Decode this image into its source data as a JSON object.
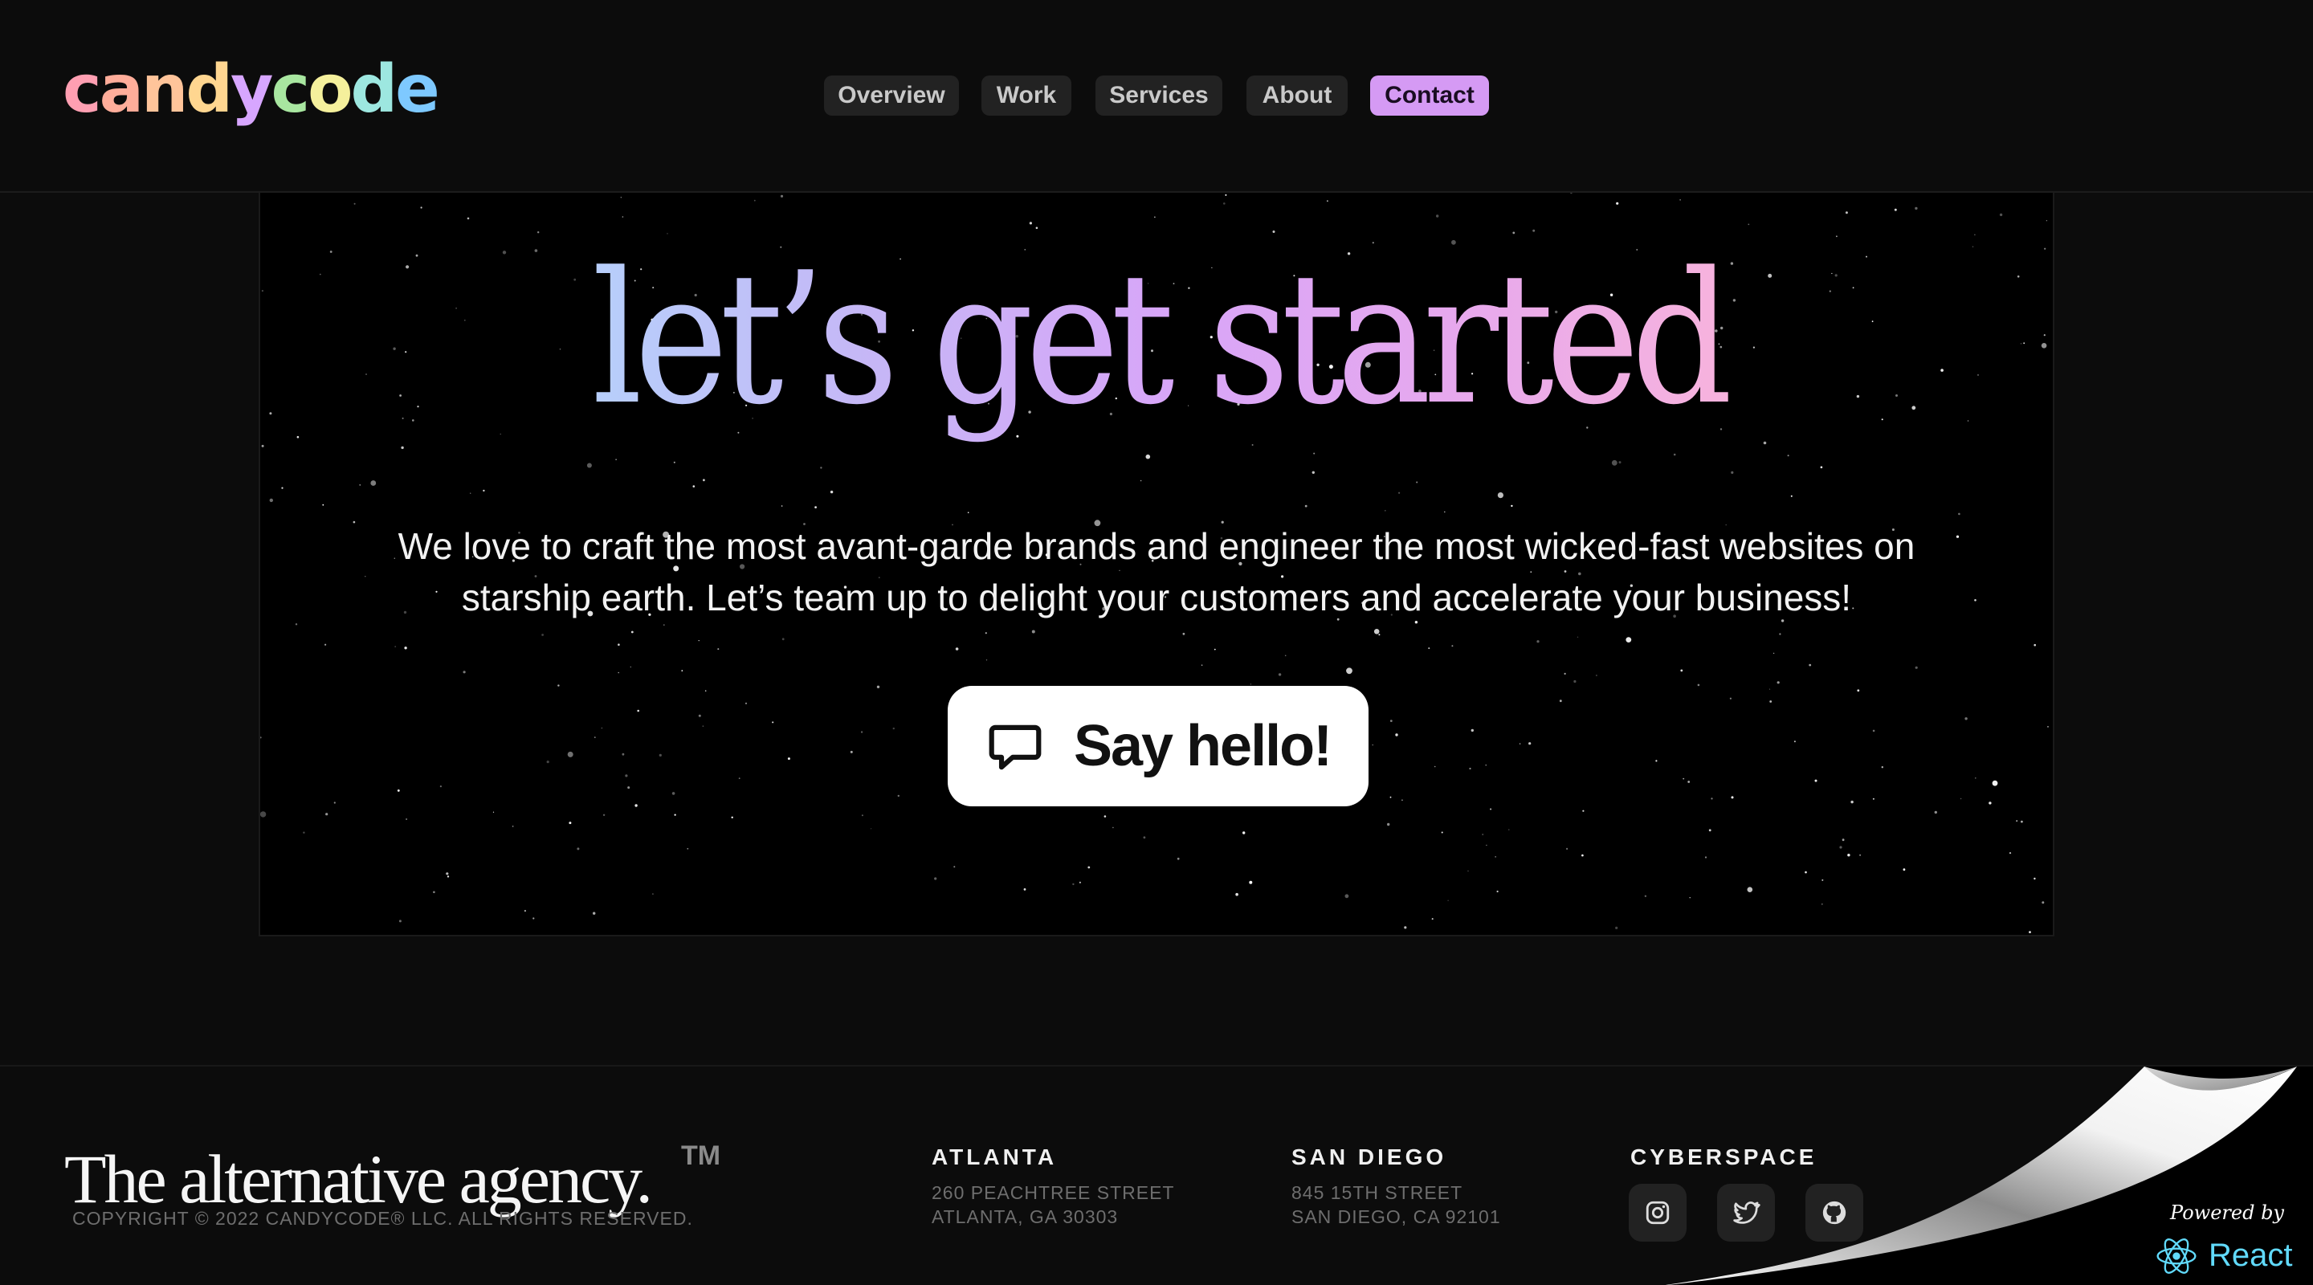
{
  "brand": {
    "logo_letters": [
      {
        "char": "c",
        "color": "#ff9fb2"
      },
      {
        "char": "a",
        "color": "#ffad9a"
      },
      {
        "char": "n",
        "color": "#ffc49a"
      },
      {
        "char": "d",
        "color": "#ffd690"
      },
      {
        "char": "y",
        "color": "#d7a6ff"
      },
      {
        "char": "c",
        "color": "#a8e6a0"
      },
      {
        "char": "o",
        "color": "#f5f09c"
      },
      {
        "char": "d",
        "color": "#9de7e0"
      },
      {
        "char": "e",
        "color": "#7ec9ff"
      }
    ]
  },
  "nav": {
    "items": [
      {
        "label": "Overview",
        "active": false
      },
      {
        "label": "Work",
        "active": false
      },
      {
        "label": "Services",
        "active": false
      },
      {
        "label": "About",
        "active": false
      },
      {
        "label": "Contact",
        "active": true
      }
    ]
  },
  "hero": {
    "headline": "let’s get started",
    "headline_gradient": [
      "#b7cffb",
      "#c6b6f6",
      "#d7a6f8",
      "#e6a8ee",
      "#f7b3dd"
    ],
    "tagline_line1": "We love to craft the most avant-garde brands and engineer the most wicked-fast websites on",
    "tagline_line2": "starship earth. Let’s team up to delight your customers and accelerate your business!",
    "cta_label": "Say hello!",
    "cta_icon": "chat-bubble-icon"
  },
  "footer": {
    "tagline": "The alternative agency.",
    "trademark": "TM",
    "copyright": "COPYRIGHT © 2022 CANDYCODE® LLC. ALL RIGHTS RESERVED.",
    "offices": [
      {
        "title": "ATLANTA",
        "line1": "260 PEACHTREE STREET",
        "line2": "ATLANTA, GA 30303"
      },
      {
        "title": "SAN DIEGO",
        "line1": "845 15TH STREET",
        "line2": "SAN DIEGO, CA 92101"
      }
    ],
    "cyberspace_title": "CYBERSPACE",
    "socials": [
      "instagram-icon",
      "twitter-icon",
      "github-icon"
    ],
    "powered_by": "Powered by",
    "powered_tech": "React",
    "react_color": "#61dafb"
  }
}
